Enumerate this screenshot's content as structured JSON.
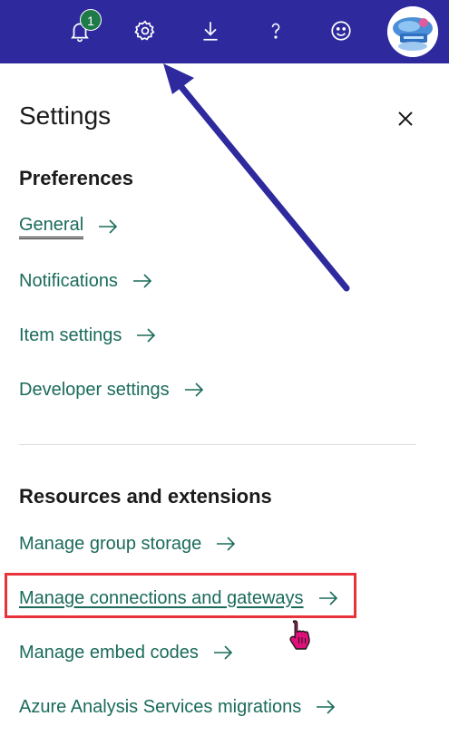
{
  "topbar": {
    "notification_count": "1",
    "icons": [
      "bell-icon",
      "gear-icon",
      "download-icon",
      "help-icon",
      "smiley-icon",
      "avatar"
    ],
    "background": "#2e2a9e"
  },
  "panel": {
    "title": "Settings",
    "preferences": {
      "heading": "Preferences",
      "items": [
        "General",
        "Notifications",
        "Item settings",
        "Developer settings"
      ]
    },
    "resources": {
      "heading": "Resources and extensions",
      "items": [
        "Manage group storage",
        "Manage connections and gateways",
        "Manage embed codes",
        "Azure Analysis Services migrations"
      ]
    }
  },
  "colors": {
    "link": "#1a6b5a",
    "highlight": "#e8333b",
    "annotation_arrow": "#2e2a9e",
    "cursor": "#e0107a"
  }
}
